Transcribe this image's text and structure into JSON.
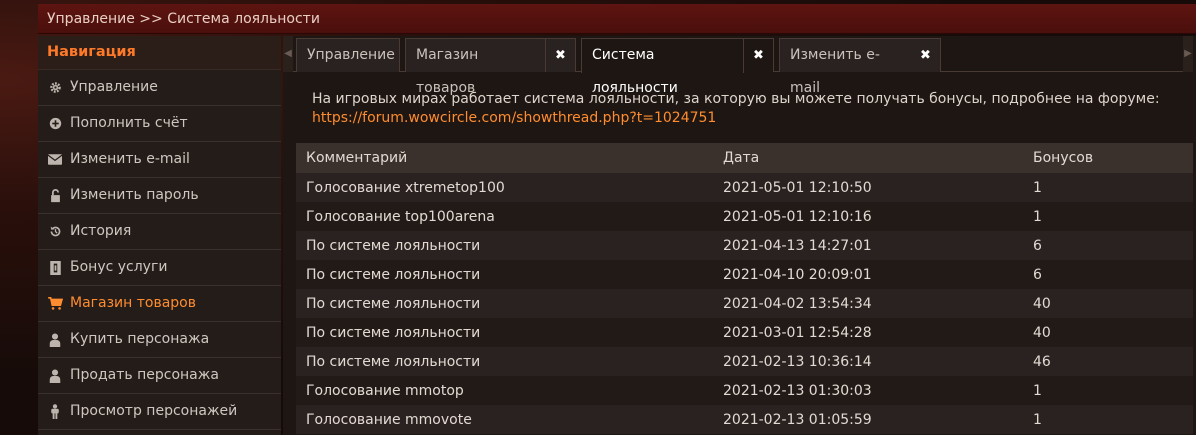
{
  "titlebar": {
    "breadcrumb": "Управление >> Система лояльности"
  },
  "sidebar": {
    "header": "Навигация",
    "items": [
      {
        "label": "Управление",
        "icon": "gear-icon",
        "active": false
      },
      {
        "label": "Пополнить счёт",
        "icon": "plus-circle-icon",
        "active": false
      },
      {
        "label": "Изменить e-mail",
        "icon": "envelope-icon",
        "active": false
      },
      {
        "label": "Изменить пароль",
        "icon": "unlock-icon",
        "active": false
      },
      {
        "label": "История",
        "icon": "history-icon",
        "active": false
      },
      {
        "label": "Бонус услуги",
        "icon": "bonus-icon",
        "active": false
      },
      {
        "label": "Магазин товаров",
        "icon": "cart-icon",
        "active": true
      },
      {
        "label": "Купить персонажа",
        "icon": "user-icon",
        "active": false
      },
      {
        "label": "Продать персонажа",
        "icon": "user-icon",
        "active": false
      },
      {
        "label": "Просмотр персонажей",
        "icon": "male-icon",
        "active": false
      }
    ]
  },
  "tabs": [
    {
      "label": "Управление",
      "closable": false,
      "active": false
    },
    {
      "label": "Магазин товаров",
      "closable": true,
      "active": false
    },
    {
      "label": "Система лояльности",
      "closable": true,
      "active": true
    },
    {
      "label": "Изменить e-mail",
      "closable": true,
      "active": false
    }
  ],
  "close_glyph": "✖",
  "intro": {
    "text": "На игровых мирах работает система лояльности, за которую вы можете получать бонусы, подробнее на форуме:",
    "link": "https://forum.wowcircle.com/showthread.php?t=1024751"
  },
  "table": {
    "headers": [
      "Комментарий",
      "Дата",
      "Бонусов"
    ],
    "rows": [
      [
        "Голосование xtremetop100",
        "2021-05-01 12:10:50",
        "1"
      ],
      [
        "Голосование top100arena",
        "2021-05-01 12:10:16",
        "1"
      ],
      [
        "По системе лояльности",
        "2021-04-13 14:27:01",
        "6"
      ],
      [
        "По системе лояльности",
        "2021-04-10 20:09:01",
        "6"
      ],
      [
        "По системе лояльности",
        "2021-04-02 13:54:34",
        "40"
      ],
      [
        "По системе лояльности",
        "2021-03-01 12:54:28",
        "40"
      ],
      [
        "По системе лояльности",
        "2021-02-13 10:36:14",
        "46"
      ],
      [
        "Голосование mmotop",
        "2021-02-13 01:30:03",
        "1"
      ],
      [
        "Голосование mmovote",
        "2021-02-13 01:05:59",
        "1"
      ]
    ]
  },
  "colors": {
    "accent": "#ff8c2e",
    "titlebar": "#5e1410"
  }
}
